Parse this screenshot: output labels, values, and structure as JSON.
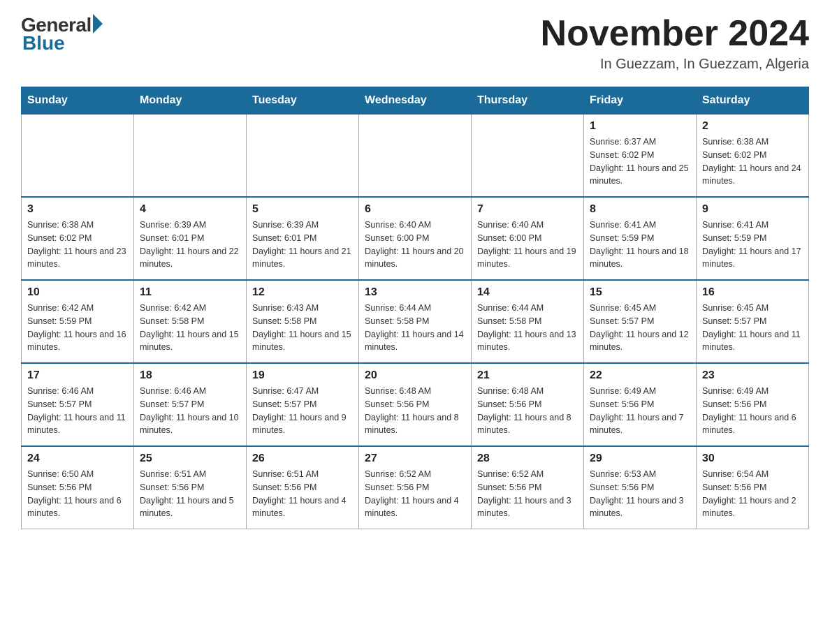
{
  "header": {
    "logo_general": "General",
    "logo_blue": "Blue",
    "month_title": "November 2024",
    "location": "In Guezzam, In Guezzam, Algeria"
  },
  "days_of_week": [
    "Sunday",
    "Monday",
    "Tuesday",
    "Wednesday",
    "Thursday",
    "Friday",
    "Saturday"
  ],
  "weeks": [
    [
      {
        "day": "",
        "info": ""
      },
      {
        "day": "",
        "info": ""
      },
      {
        "day": "",
        "info": ""
      },
      {
        "day": "",
        "info": ""
      },
      {
        "day": "",
        "info": ""
      },
      {
        "day": "1",
        "info": "Sunrise: 6:37 AM\nSunset: 6:02 PM\nDaylight: 11 hours and 25 minutes."
      },
      {
        "day": "2",
        "info": "Sunrise: 6:38 AM\nSunset: 6:02 PM\nDaylight: 11 hours and 24 minutes."
      }
    ],
    [
      {
        "day": "3",
        "info": "Sunrise: 6:38 AM\nSunset: 6:02 PM\nDaylight: 11 hours and 23 minutes."
      },
      {
        "day": "4",
        "info": "Sunrise: 6:39 AM\nSunset: 6:01 PM\nDaylight: 11 hours and 22 minutes."
      },
      {
        "day": "5",
        "info": "Sunrise: 6:39 AM\nSunset: 6:01 PM\nDaylight: 11 hours and 21 minutes."
      },
      {
        "day": "6",
        "info": "Sunrise: 6:40 AM\nSunset: 6:00 PM\nDaylight: 11 hours and 20 minutes."
      },
      {
        "day": "7",
        "info": "Sunrise: 6:40 AM\nSunset: 6:00 PM\nDaylight: 11 hours and 19 minutes."
      },
      {
        "day": "8",
        "info": "Sunrise: 6:41 AM\nSunset: 5:59 PM\nDaylight: 11 hours and 18 minutes."
      },
      {
        "day": "9",
        "info": "Sunrise: 6:41 AM\nSunset: 5:59 PM\nDaylight: 11 hours and 17 minutes."
      }
    ],
    [
      {
        "day": "10",
        "info": "Sunrise: 6:42 AM\nSunset: 5:59 PM\nDaylight: 11 hours and 16 minutes."
      },
      {
        "day": "11",
        "info": "Sunrise: 6:42 AM\nSunset: 5:58 PM\nDaylight: 11 hours and 15 minutes."
      },
      {
        "day": "12",
        "info": "Sunrise: 6:43 AM\nSunset: 5:58 PM\nDaylight: 11 hours and 15 minutes."
      },
      {
        "day": "13",
        "info": "Sunrise: 6:44 AM\nSunset: 5:58 PM\nDaylight: 11 hours and 14 minutes."
      },
      {
        "day": "14",
        "info": "Sunrise: 6:44 AM\nSunset: 5:58 PM\nDaylight: 11 hours and 13 minutes."
      },
      {
        "day": "15",
        "info": "Sunrise: 6:45 AM\nSunset: 5:57 PM\nDaylight: 11 hours and 12 minutes."
      },
      {
        "day": "16",
        "info": "Sunrise: 6:45 AM\nSunset: 5:57 PM\nDaylight: 11 hours and 11 minutes."
      }
    ],
    [
      {
        "day": "17",
        "info": "Sunrise: 6:46 AM\nSunset: 5:57 PM\nDaylight: 11 hours and 11 minutes."
      },
      {
        "day": "18",
        "info": "Sunrise: 6:46 AM\nSunset: 5:57 PM\nDaylight: 11 hours and 10 minutes."
      },
      {
        "day": "19",
        "info": "Sunrise: 6:47 AM\nSunset: 5:57 PM\nDaylight: 11 hours and 9 minutes."
      },
      {
        "day": "20",
        "info": "Sunrise: 6:48 AM\nSunset: 5:56 PM\nDaylight: 11 hours and 8 minutes."
      },
      {
        "day": "21",
        "info": "Sunrise: 6:48 AM\nSunset: 5:56 PM\nDaylight: 11 hours and 8 minutes."
      },
      {
        "day": "22",
        "info": "Sunrise: 6:49 AM\nSunset: 5:56 PM\nDaylight: 11 hours and 7 minutes."
      },
      {
        "day": "23",
        "info": "Sunrise: 6:49 AM\nSunset: 5:56 PM\nDaylight: 11 hours and 6 minutes."
      }
    ],
    [
      {
        "day": "24",
        "info": "Sunrise: 6:50 AM\nSunset: 5:56 PM\nDaylight: 11 hours and 6 minutes."
      },
      {
        "day": "25",
        "info": "Sunrise: 6:51 AM\nSunset: 5:56 PM\nDaylight: 11 hours and 5 minutes."
      },
      {
        "day": "26",
        "info": "Sunrise: 6:51 AM\nSunset: 5:56 PM\nDaylight: 11 hours and 4 minutes."
      },
      {
        "day": "27",
        "info": "Sunrise: 6:52 AM\nSunset: 5:56 PM\nDaylight: 11 hours and 4 minutes."
      },
      {
        "day": "28",
        "info": "Sunrise: 6:52 AM\nSunset: 5:56 PM\nDaylight: 11 hours and 3 minutes."
      },
      {
        "day": "29",
        "info": "Sunrise: 6:53 AM\nSunset: 5:56 PM\nDaylight: 11 hours and 3 minutes."
      },
      {
        "day": "30",
        "info": "Sunrise: 6:54 AM\nSunset: 5:56 PM\nDaylight: 11 hours and 2 minutes."
      }
    ]
  ]
}
